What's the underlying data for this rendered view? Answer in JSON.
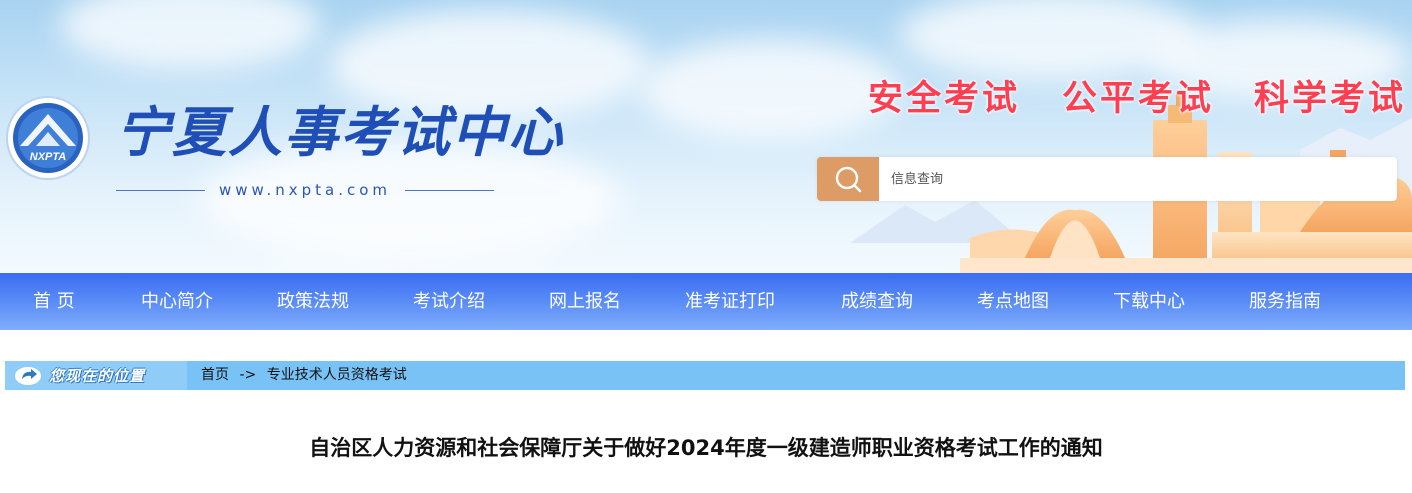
{
  "header": {
    "logo_text": "NXPTA",
    "site_title": "宁夏人事考试中心",
    "site_url": "www.nxpta.com",
    "slogans": [
      "安全考试",
      "公平考试",
      "科学考试"
    ],
    "slogan_color": "#ff3f51",
    "title_color": "#1f4fb6"
  },
  "search": {
    "placeholder": "信息查询",
    "button_color": "#dd9b65",
    "icon": "search-icon"
  },
  "nav": {
    "items": [
      "首  页",
      "中心简介",
      "政策法规",
      "考试介绍",
      "网上报名",
      "准考证打印",
      "成绩查询",
      "考点地图",
      "下载中心",
      "服务指南"
    ],
    "gradient": [
      "#3a6df2",
      "#80aefb"
    ]
  },
  "breadcrumb": {
    "badge_label": "您现在的位置",
    "badge_icon": "location-arrow-icon",
    "home": "首页",
    "separator": "->",
    "current": "专业技术人员资格考试"
  },
  "article": {
    "title": "自治区人力资源和社会保障厅关于做好2024年度一级建造师职业资格考试工作的通知"
  }
}
